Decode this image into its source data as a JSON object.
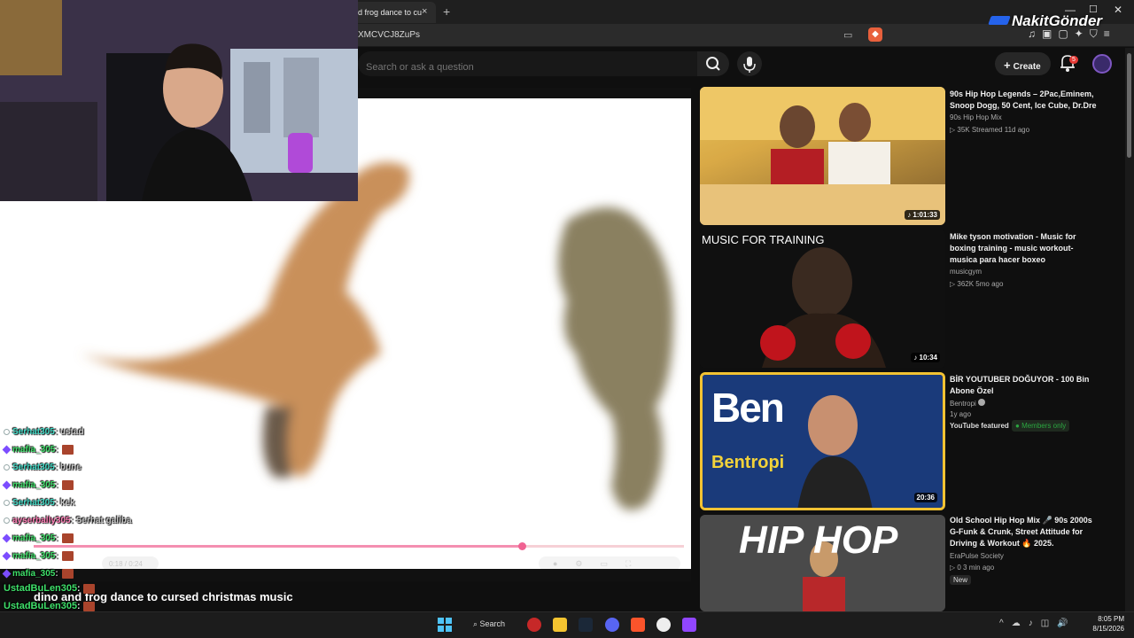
{
  "browser": {
    "tab_title": "d frog dance to cu",
    "tab_close": "×",
    "new_tab": "+",
    "url": "XMCVCJ8ZuPs",
    "window_controls": {
      "minimize": "—",
      "maximize": "☐",
      "close": "✕"
    }
  },
  "overlay": {
    "brand": "NakitGönder"
  },
  "youtube": {
    "search_placeholder": "Search or ask a question",
    "create_label": "Create",
    "create_plus": "+",
    "notification_count": "5"
  },
  "player": {
    "video_title": "dino and frog dance to cursed christmas music",
    "time_display": "0:18 / 0:24",
    "progress_fraction": 0.75
  },
  "chat": [
    {
      "user": "Serhat305",
      "message": ": ustad",
      "emote": false,
      "type": "normal"
    },
    {
      "user": "mafia_305",
      "message": ":",
      "emote": true,
      "type": "sub"
    },
    {
      "user": "Serhat305",
      "message": ": bune",
      "emote": false,
      "type": "normal"
    },
    {
      "user": "mafia_305",
      "message": ":",
      "emote": true,
      "type": "sub"
    },
    {
      "user": "Serhat305",
      "message": ": kek",
      "emote": false,
      "type": "normal"
    },
    {
      "user": "ayserbally305",
      "message": ": Serhat galiba",
      "emote": false,
      "type": "pink"
    },
    {
      "user": "mafia_305",
      "message": ":",
      "emote": true,
      "type": "sub"
    },
    {
      "user": "mafia_305",
      "message": ":",
      "emote": true,
      "type": "sub"
    },
    {
      "user": "mafia_305",
      "message": ":",
      "emote": true,
      "type": "sub"
    },
    {
      "user": "UstadBuLen305",
      "message": ":",
      "emote": true,
      "type": "ustad"
    },
    {
      "user": "UstadBuLen305",
      "message": ":",
      "emote": true,
      "type": "ustad"
    },
    {
      "user": "UstadBuLen305",
      "message": ":",
      "emote": true,
      "type": "ustad"
    }
  ],
  "recommendations": [
    {
      "title": "90s Hip Hop Legends – 2Pac,Eminem, Snoop Dogg, 50 Cent, Ice Cube, Dr.Dre",
      "channel": "90s Hip Hop Mix",
      "meta": "▷ 35K  Streamed 11d ago",
      "duration": "♪ 1:01:33",
      "thumb_text": ""
    },
    {
      "title": "Mike tyson motivation - Music for boxing training - music workout- musica para hacer boxeo",
      "channel": "musicgym",
      "meta": "▷ 362K  5mo ago",
      "duration": "♪ 10:34",
      "thumb_text": "MUSIC FOR TRAINING"
    },
    {
      "title": "BİR YOUTUBER DOĞUYOR - 100 Bin Abone Özel",
      "channel": "Bentropi",
      "meta": "1y ago",
      "tag": "YouTube featured",
      "members": "Members only",
      "duration": "20:36",
      "thumb_text": "Bentropi",
      "thumb_big": "Ben"
    },
    {
      "title": "Old School Hip Hop Mix 🎤 90s 2000s G-Funk & Crunk, Street Attitude for Driving & Workout 🔥 2025.",
      "channel": "EraPulse Society",
      "meta": "▷ 0  3 min ago",
      "new_badge": "New",
      "thumb_text": "HIP HOP"
    }
  ],
  "taskbar": {
    "search_label": "Search",
    "time": "8:05 PM",
    "date": "8/15/2026"
  },
  "colors": {
    "accent_red": "#e53935",
    "highlight_gold": "#f2c233",
    "chat_name": "#3fd8c4"
  }
}
